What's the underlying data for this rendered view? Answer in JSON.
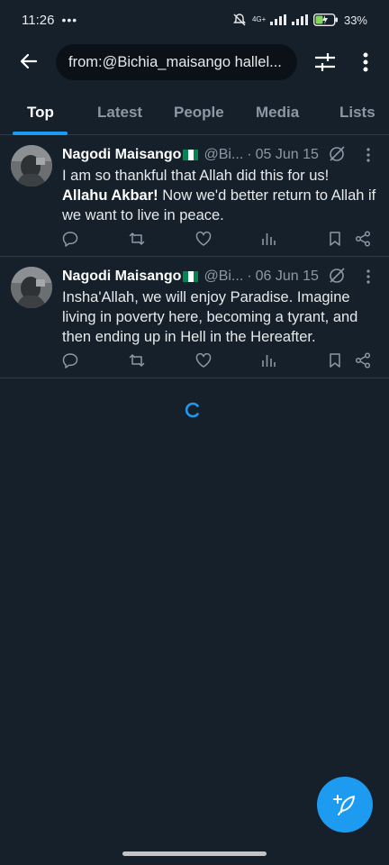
{
  "status_bar": {
    "time": "11:26",
    "dots": "•••",
    "network": "4G+",
    "battery": "33%"
  },
  "header": {
    "search_query": "from:@Bichia_maisango hallel..."
  },
  "tabs": [
    {
      "label": "Top",
      "active": true
    },
    {
      "label": "Latest",
      "active": false
    },
    {
      "label": "People",
      "active": false
    },
    {
      "label": "Media",
      "active": false
    },
    {
      "label": "Lists",
      "active": false
    }
  ],
  "tweets": [
    {
      "name": "Nagodi Maisango",
      "handle": "@Bi...",
      "date": "05 Jun 15",
      "text_line1": "I am so thankful that Allah did this for us!",
      "text_bold": "Allahu Akbar!",
      "text_rest": " Now we'd better return to Allah if we want to live in peace."
    },
    {
      "name": "Nagodi Maisango",
      "handle": "@Bi...",
      "date": "06 Jun 15",
      "text": "Insha'Allah, we will enjoy Paradise. Imagine living in poverty here, becoming a tyrant, and then ending up in Hell in the Hereafter."
    }
  ],
  "icons": {
    "back": "arrow-left-icon",
    "filter": "sliders-icon",
    "more": "more-vertical-icon",
    "grok": "grok-icon",
    "reply": "reply-icon",
    "retweet": "retweet-icon",
    "like": "heart-icon",
    "views": "analytics-icon",
    "bookmark": "bookmark-icon",
    "share": "share-icon",
    "compose": "compose-post-icon",
    "loading": "loading-spinner-icon"
  },
  "colors": {
    "background": "#15202b",
    "accent": "#1d9bf0",
    "muted": "#8b98a5",
    "flag_green": "#008751",
    "flag_white": "#ffffff"
  }
}
